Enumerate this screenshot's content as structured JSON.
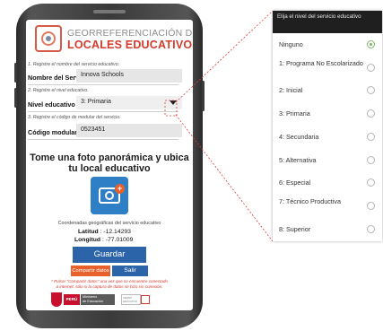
{
  "app": {
    "title_line1": "GEORREFERENCIACIÓN DE",
    "title_line2": "LOCALES EDUCATIVOS"
  },
  "form": {
    "step1_instruction": "1. Registre el nombre del servicio educativo.",
    "service_name_label": "Nombre del Servicio",
    "service_name_value": "Innova Schools",
    "step2_instruction": "2. Registre el nivel educativo.",
    "level_label": "Nivel educativo",
    "level_value": "3: Primaria",
    "step3_instruction": "3. Registre el código de modular del servicio.",
    "modular_code_label": "Código modular",
    "modular_code_value": "0523451"
  },
  "photo": {
    "title_line1": "Tome una foto panorámica y ubica",
    "title_line2": "tu local educativo"
  },
  "coords": {
    "title": "Coordenadas geográficas del servicio educativo",
    "lat_label": "Latitud",
    "lat_value": ": -12.14293",
    "lon_label": "Longitud",
    "lon_value": ": -77.01009"
  },
  "buttons": {
    "save": "Guardar",
    "share": "Compartir datos",
    "exit": "Salir"
  },
  "note": {
    "line1": "* Pulsar \"Compartir datos\" una vez que se encuentre conectado",
    "line2": "a internet, sólo si la captura de datos se hizo sin conexión."
  },
  "footer": {
    "peru": "PERÚ",
    "ministry_line1": "Ministerio",
    "ministry_line2": "de Educación",
    "censo_line1": "CENSO",
    "censo_line2": "EDUCATIVO"
  },
  "dropdown": {
    "header": "Elija el nivel del servicio educativo",
    "selected_index": 0,
    "options": [
      "Ninguno",
      "1: Programa No Escolarizado",
      "2: Inicial",
      "3: Primaria",
      "4: Secundaria",
      "5: Alternativa",
      "6: Especial",
      "7: Técnico Productiva",
      "8: Superior"
    ]
  },
  "colors": {
    "brand_red": "#d33a2c",
    "primary_blue": "#2b64a8",
    "accent_orange": "#e8602c",
    "radio_green": "#7bb661"
  }
}
